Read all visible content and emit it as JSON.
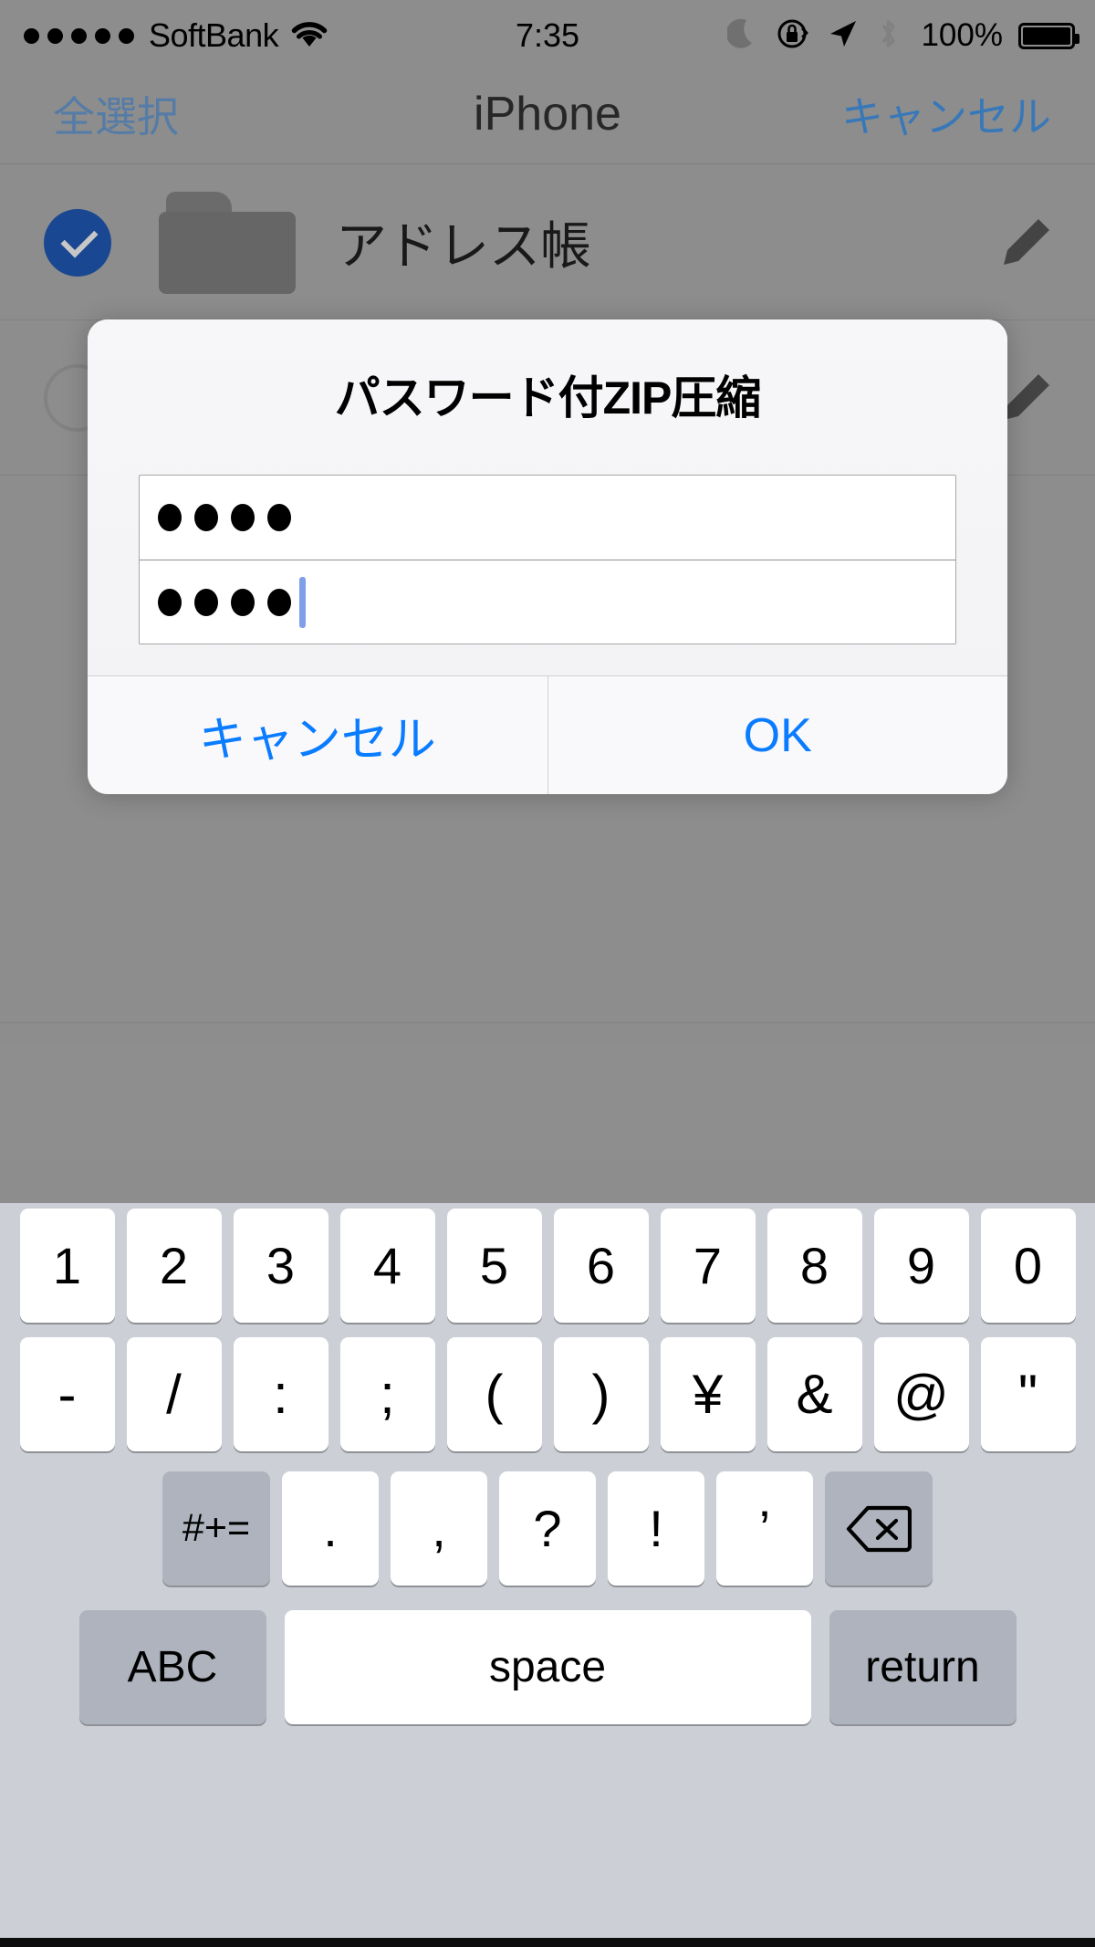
{
  "status_bar": {
    "signal_dots": 5,
    "carrier": "SoftBank",
    "wifi_icon": "wifi-icon",
    "time": "7:35",
    "do_not_disturb_icon": "moon-icon",
    "rotation_lock_icon": "rotation-lock-icon",
    "location_icon": "location-arrow-icon",
    "bluetooth_icon": "bluetooth-icon",
    "battery_percent": "100%",
    "battery_level": 100
  },
  "nav_bar": {
    "left_button": "全選択",
    "title": "iPhone",
    "right_button": "キャンセル"
  },
  "content": {
    "rows": [
      {
        "label": "アドレス帳",
        "checked": true,
        "icon": "folder-icon",
        "accessory": "pencil-icon"
      },
      {
        "label": "",
        "checked": false,
        "icon": "folder-icon",
        "accessory": "pencil-icon"
      },
      {
        "label": "",
        "checked": false,
        "icon": "",
        "accessory": ""
      }
    ]
  },
  "alert": {
    "title": "パスワード付ZIP圧縮",
    "fields": [
      {
        "name": "password",
        "dots": 4,
        "focused": false,
        "placeholder": ""
      },
      {
        "name": "password-confirm",
        "dots": 4,
        "focused": true,
        "placeholder": ""
      }
    ],
    "cancel_label": "キャンセル",
    "ok_label": "OK",
    "accent_color": "#0a7cff"
  },
  "keyboard": {
    "number_row": [
      "1",
      "2",
      "3",
      "4",
      "5",
      "6",
      "7",
      "8",
      "9",
      "0"
    ],
    "symbol_row": [
      "-",
      "/",
      ":",
      ";",
      "(",
      ")",
      "¥",
      "&",
      "@",
      "\""
    ],
    "alt_key": "#+=",
    "punct_row": [
      ".",
      ",",
      "?",
      "!",
      "’"
    ],
    "delete_icon": "delete-backspace-icon",
    "abc_key": "ABC",
    "space_key": "space",
    "return_key": "return"
  }
}
